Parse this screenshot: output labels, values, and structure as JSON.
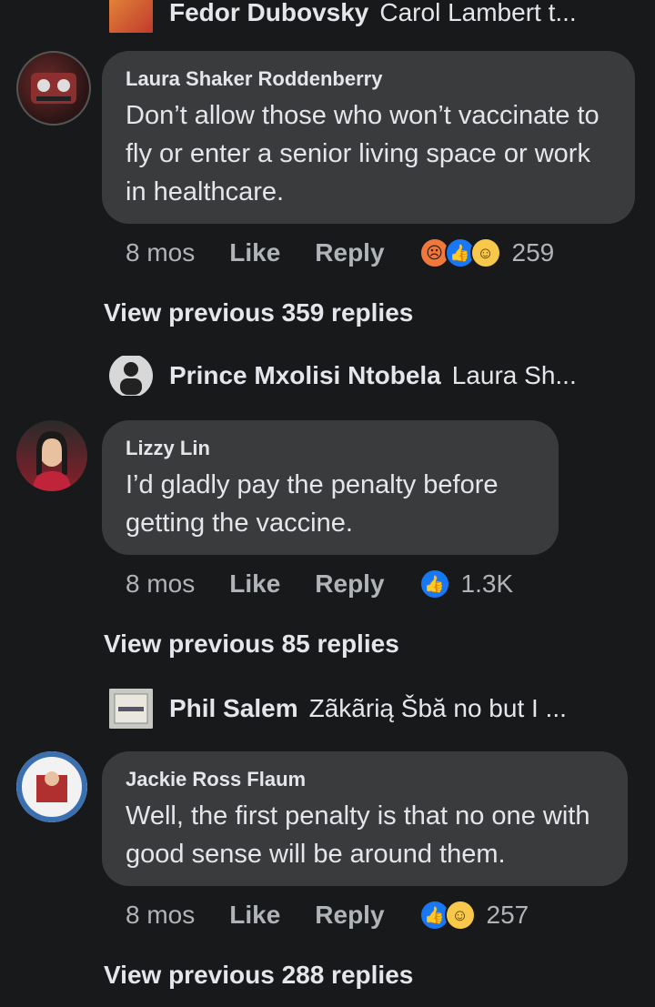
{
  "top_reply": {
    "name": "Fedor Dubovsky",
    "text": "Carol Lambert t..."
  },
  "comments": [
    {
      "author": "Laura Shaker Roddenberry",
      "text": "Don’t allow those who won’t vaccinate to fly or enter a senior living space or work in healthcare.",
      "time": "8 mos",
      "like": "Like",
      "reply": "Reply",
      "reactions": [
        "angry",
        "like",
        "haha"
      ],
      "count": "259",
      "view_previous": "View previous 359 replies",
      "preview": {
        "name": "Prince Mxolisi Ntobela",
        "text": "Laura Sh..."
      }
    },
    {
      "author": "Lizzy Lin",
      "text": "I’d gladly pay the penalty before getting the vaccine.",
      "time": "8 mos",
      "like": "Like",
      "reply": "Reply",
      "reactions": [
        "like"
      ],
      "count": "1.3K",
      "view_previous": "View previous 85 replies",
      "preview": {
        "name": "Phil Salem",
        "text": "Zãkãrią Šbă no but I ..."
      }
    },
    {
      "author": "Jackie Ross Flaum",
      "text": "Well, the first penalty is that no one with good sense will be around them.",
      "time": "8 mos",
      "like": "Like",
      "reply": "Reply",
      "reactions": [
        "like",
        "haha"
      ],
      "count": "257",
      "view_previous": "View previous 288 replies"
    }
  ],
  "colors": {
    "background": "#18191a",
    "bubble": "#3a3b3c",
    "meta": "#b0b3b8",
    "like_blue": "#1877f2"
  }
}
